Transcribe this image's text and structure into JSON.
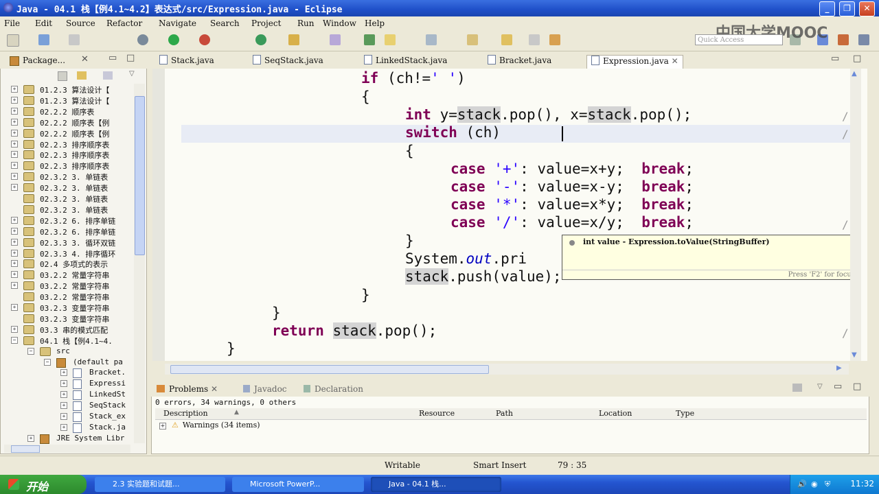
{
  "window": {
    "title": "Java - 04.1  栈【例4.1~4.2】表达式/src/Expression.java - Eclipse",
    "watermark": "中国大学MOOC"
  },
  "menu": [
    "File",
    "Edit",
    "Source",
    "Refactor",
    "Navigate",
    "Search",
    "Project",
    "Run",
    "Window",
    "Help"
  ],
  "quick_access": {
    "placeholder": "Quick Access"
  },
  "package_explorer": {
    "title": "Package...",
    "items": [
      {
        "label": "01.2.3  算法设计【",
        "expand": "+",
        "icon": "project"
      },
      {
        "label": "01.2.3  算法设计【",
        "expand": "+",
        "icon": "project"
      },
      {
        "label": "02.2.2  顺序表",
        "expand": "+",
        "icon": "project"
      },
      {
        "label": "02.2.2  顺序表【例",
        "expand": "+",
        "icon": "project"
      },
      {
        "label": "02.2.2  顺序表【例",
        "expand": "+",
        "icon": "project"
      },
      {
        "label": "02.2.3  排序顺序表",
        "expand": "+",
        "icon": "project"
      },
      {
        "label": "02.2.3  排序顺序表",
        "expand": "+",
        "icon": "project"
      },
      {
        "label": "02.2.3  排序顺序表",
        "expand": "+",
        "icon": "project"
      },
      {
        "label": "02.3.2  3.  单链表",
        "expand": "+",
        "icon": "project"
      },
      {
        "label": "02.3.2  3.  单链表",
        "expand": "+",
        "icon": "project"
      },
      {
        "label": "02.3.2  3.  单链表",
        "expand": "",
        "icon": "project"
      },
      {
        "label": "02.3.2  3.  单链表",
        "expand": "",
        "icon": "project"
      },
      {
        "label": "02.3.2  6.  排序单链",
        "expand": "+",
        "icon": "project"
      },
      {
        "label": "02.3.2  6.  排序单链",
        "expand": "+",
        "icon": "project"
      },
      {
        "label": "02.3.3  3.  循环双链",
        "expand": "+",
        "icon": "project"
      },
      {
        "label": "02.3.3  4.  排序循环",
        "expand": "+",
        "icon": "project"
      },
      {
        "label": "02.4   多项式的表示",
        "expand": "+",
        "icon": "project"
      },
      {
        "label": "03.2.2  常量字符串",
        "expand": "+",
        "icon": "project"
      },
      {
        "label": "03.2.2  常量字符串",
        "expand": "+",
        "icon": "project"
      },
      {
        "label": "03.2.2  常量字符串",
        "expand": "",
        "icon": "project"
      },
      {
        "label": "03.2.3  变量字符串",
        "expand": "+",
        "icon": "project"
      },
      {
        "label": "03.2.3  变量字符串",
        "expand": "",
        "icon": "project"
      },
      {
        "label": "03.3   串的模式匹配",
        "expand": "+",
        "icon": "project"
      },
      {
        "label": "04.1   栈【例4.1~4.",
        "expand": "−",
        "icon": "project"
      },
      {
        "label": "src",
        "expand": "−",
        "icon": "folder",
        "indent": 1
      },
      {
        "label": "(default pa",
        "expand": "−",
        "icon": "package",
        "indent": 2
      },
      {
        "label": "Bracket.",
        "expand": "+",
        "icon": "java",
        "indent": 3
      },
      {
        "label": "Expressi",
        "expand": "+",
        "icon": "java",
        "indent": 3
      },
      {
        "label": "LinkedSt",
        "expand": "+",
        "icon": "java",
        "indent": 3
      },
      {
        "label": "SeqStack",
        "expand": "+",
        "icon": "java",
        "indent": 3
      },
      {
        "label": "Stack_ex",
        "expand": "+",
        "icon": "java",
        "indent": 3
      },
      {
        "label": "Stack.ja",
        "expand": "+",
        "icon": "java",
        "indent": 3
      },
      {
        "label": "JRE System Libr",
        "expand": "+",
        "icon": "package",
        "indent": 1
      }
    ]
  },
  "editor_tabs": [
    {
      "label": "Stack.java",
      "active": false
    },
    {
      "label": "SeqStack.java",
      "active": false
    },
    {
      "label": "LinkedStack.java",
      "active": false
    },
    {
      "label": "Bracket.java",
      "active": false
    },
    {
      "label": "Expression.java",
      "active": true
    }
  ],
  "code": {
    "l1_kw": "if",
    "l1_rest": " (ch!=",
    "l1_str": "' '",
    "l1_end": ")",
    "l2": "{",
    "l3_kw": "int",
    "l3_a": " y=",
    "l3_stack": "stack",
    "l3_b": ".pop(), x=",
    "l3_stack2": "stack",
    "l3_c": ".pop();",
    "l4_kw": "switch",
    "l4_rest": " (ch)",
    "l5": "{",
    "case_kw": "case",
    "c1_str": "'+'",
    "c1_rest": ": value=x+y;  ",
    "c2_str": "'-'",
    "c2_rest": ": value=x-y;  ",
    "c3_str": "'*'",
    "c3_rest": ": value=x*y;  ",
    "c4_str": "'/'",
    "c4_rest": ": value=x/y;  ",
    "break_kw": "break",
    "semi": ";",
    "l10": "}",
    "l11_a": "System.",
    "l11_fld": "out",
    "l11_b": ".pri",
    "l12_stack": "stack",
    "l12_b": ".push(value);",
    "l13": "}",
    "l14": "}",
    "l15_kw": "return",
    "l15_stack": "stack",
    "l15_b": ".pop();",
    "l16": "}",
    "slash": "/"
  },
  "tooltip": {
    "signature": "int value - Expression.toValue(StringBuffer)",
    "hint": "Press 'F2' for focus"
  },
  "bottom": {
    "tabs": [
      {
        "label": "Problems",
        "active": true
      },
      {
        "label": "Javadoc",
        "active": false
      },
      {
        "label": "Declaration",
        "active": false
      }
    ],
    "summary": "0 errors, 34 warnings, 0 others",
    "columns": [
      "Description",
      "Resource",
      "Path",
      "Location",
      "Type"
    ],
    "rows": [
      {
        "label": "Warnings (34 items)"
      }
    ]
  },
  "status": {
    "writable": "Writable",
    "insert_mode": "Smart Insert",
    "position": "79 : 35"
  },
  "taskbar": {
    "start": "开始",
    "tasks": [
      {
        "label": "2.3 实验题和试题..."
      },
      {
        "label": "Microsoft PowerP..."
      },
      {
        "label": "Java - 04.1  栈..."
      }
    ],
    "clock": "11:32"
  }
}
